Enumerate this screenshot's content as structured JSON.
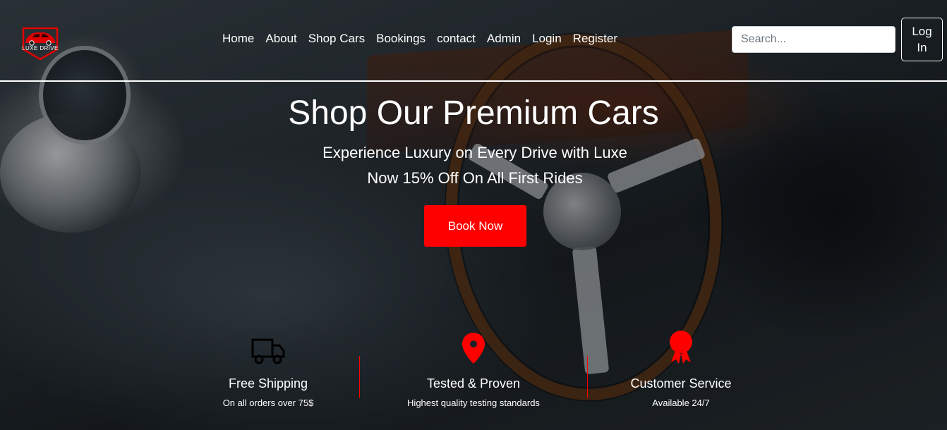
{
  "brand": {
    "logo_text": "LUXE DRIVE"
  },
  "nav": {
    "items": [
      {
        "label": "Home"
      },
      {
        "label": "About"
      },
      {
        "label": "Shop Cars"
      },
      {
        "label": "Bookings"
      },
      {
        "label": "contact"
      },
      {
        "label": "Admin"
      },
      {
        "label": "Login"
      },
      {
        "label": "Register"
      }
    ]
  },
  "search": {
    "placeholder": "Search..."
  },
  "login_button": {
    "line1": "Log",
    "line2": "In"
  },
  "hero": {
    "title": "Shop Our Premium Cars",
    "subtitle": "Experience Luxury on Every Drive with Luxe",
    "offer": "Now 15% Off On All First Rides",
    "cta": "Book Now"
  },
  "features": [
    {
      "icon": "truck-icon",
      "title": "Free Shipping",
      "desc": "On all orders over 75$"
    },
    {
      "icon": "map-pin-icon",
      "title": "Tested & Proven",
      "desc": "Highest quality testing standards"
    },
    {
      "icon": "award-icon",
      "title": "Customer Service",
      "desc": "Available 24/7"
    }
  ],
  "colors": {
    "accent": "#ff0000",
    "text": "#ffffff"
  }
}
